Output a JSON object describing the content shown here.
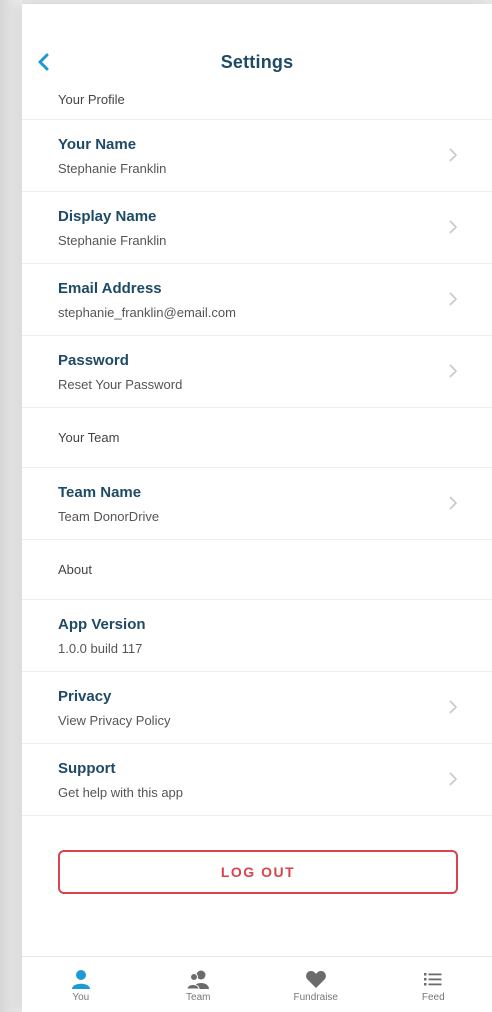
{
  "header": {
    "title": "Settings",
    "back_icon": "chevron-left-icon"
  },
  "sections": [
    {
      "title": "Your Profile",
      "rows": [
        {
          "label": "Your Name",
          "value": "Stephanie Franklin",
          "chevron": true
        },
        {
          "label": "Display Name",
          "value": "Stephanie Franklin",
          "chevron": true
        },
        {
          "label": "Email Address",
          "value": "stephanie_franklin@email.com",
          "chevron": true
        },
        {
          "label": "Password",
          "value": "Reset Your Password",
          "chevron": true
        }
      ]
    },
    {
      "title": "Your Team",
      "rows": [
        {
          "label": "Team Name",
          "value": "Team DonorDrive",
          "chevron": true
        }
      ]
    },
    {
      "title": "About",
      "rows": [
        {
          "label": "App Version",
          "value": "1.0.0 build 117",
          "chevron": false
        },
        {
          "label": "Privacy",
          "value": "View Privacy Policy",
          "chevron": true
        },
        {
          "label": "Support",
          "value": "Get help with this app",
          "chevron": true
        }
      ]
    }
  ],
  "logout": {
    "label": "LOG OUT"
  },
  "tabs": [
    {
      "label": "You",
      "icon": "person-icon",
      "active": true
    },
    {
      "label": "Team",
      "icon": "team-icon",
      "active": false
    },
    {
      "label": "Fundraise",
      "icon": "heart-icon",
      "active": false
    },
    {
      "label": "Feed",
      "icon": "list-icon",
      "active": false
    }
  ],
  "colors": {
    "accent": "#1d9ad6",
    "heading": "#1f4a66",
    "danger": "#d9434b",
    "inactive_icon": "#6b6b6b"
  }
}
